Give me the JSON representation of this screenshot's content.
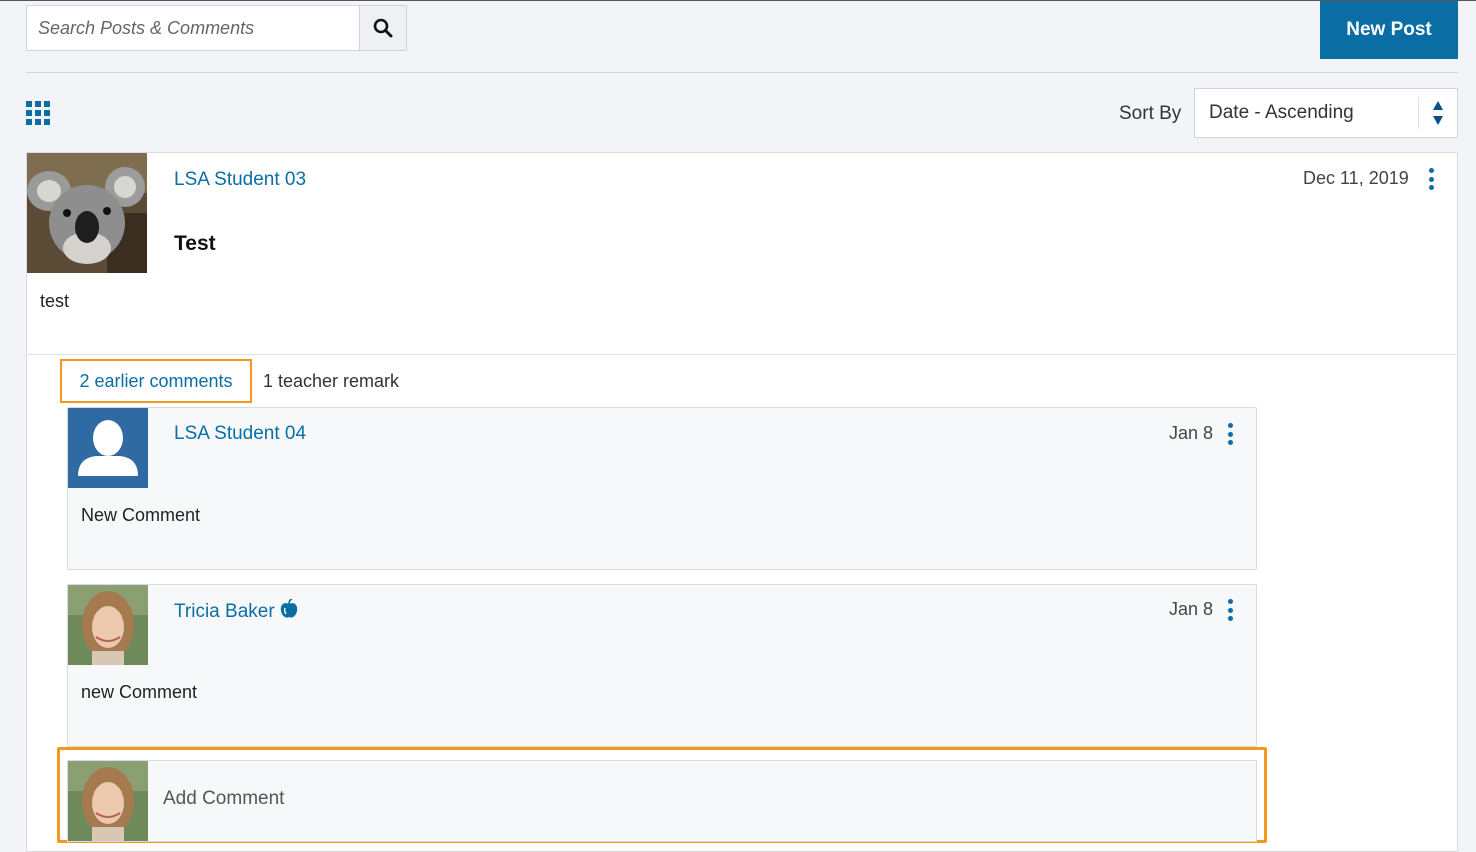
{
  "toolbar": {
    "search_placeholder": "Search Posts & Comments",
    "new_post_label": "New Post",
    "sort_label": "Sort By",
    "sort_value": "Date - Ascending"
  },
  "colors": {
    "accent": "#0a6ea5",
    "highlight": "#f7981d",
    "background": "#f2f4f7"
  },
  "post": {
    "author": "LSA Student 03",
    "date": "Dec 11, 2019",
    "title": "Test",
    "body": "test",
    "earlier_comments": "2 earlier comments",
    "teacher_remarks": "1 teacher remark"
  },
  "comments": [
    {
      "author": "LSA Student 04",
      "date": "Jan 8",
      "body": "New Comment",
      "teacher": false
    },
    {
      "author": "Tricia Baker",
      "date": "Jan 8",
      "body": "new Comment",
      "teacher": true
    }
  ],
  "add_comment": {
    "placeholder": "Add Comment"
  }
}
